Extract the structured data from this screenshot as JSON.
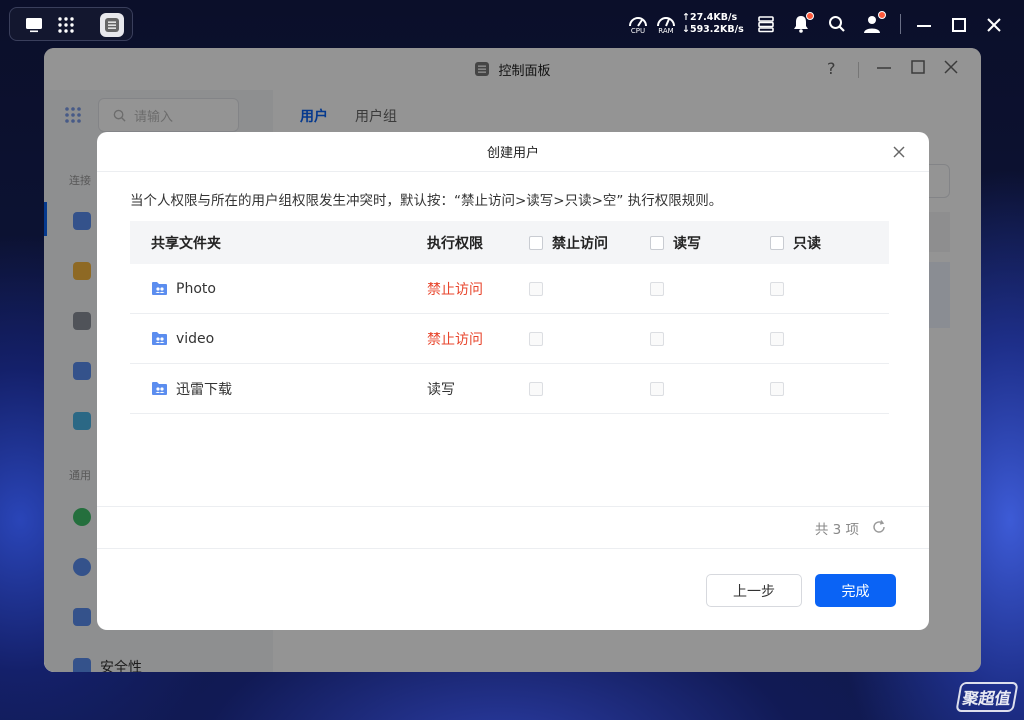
{
  "system": {
    "cpu_label": "CPU",
    "ram_label": "RAM",
    "upload_speed": "↑27.4KB/s",
    "download_speed": "↓593.2KB/s"
  },
  "window": {
    "title": "控制面板",
    "help_label": "?"
  },
  "sidebar": {
    "search_placeholder": "请输入",
    "group_connect": "连接",
    "group_general": "通用",
    "security_label": "安全性"
  },
  "tabs": {
    "users": "用户",
    "groups": "用户组",
    "active_color": "#0a63f5"
  },
  "dialog": {
    "title": "创建用户",
    "note": "当个人权限与所在的用户组权限发生冲突时，默认按：“禁止访问>读写>只读>空” 执行权限规则。",
    "columns": {
      "folder": "共享文件夹",
      "effective": "执行权限",
      "deny": "禁止访问",
      "readwrite": "读写",
      "readonly": "只读"
    },
    "rows": [
      {
        "name": "Photo",
        "effective": "禁止访问"
      },
      {
        "name": "video",
        "effective": "禁止访问"
      },
      {
        "name": "迅雷下载",
        "effective": "读写"
      }
    ],
    "count_text": "共 3 项",
    "prev_button": "上一步",
    "done_button": "完成",
    "deny_color": "#e8462d"
  },
  "watermark": "聚超值"
}
